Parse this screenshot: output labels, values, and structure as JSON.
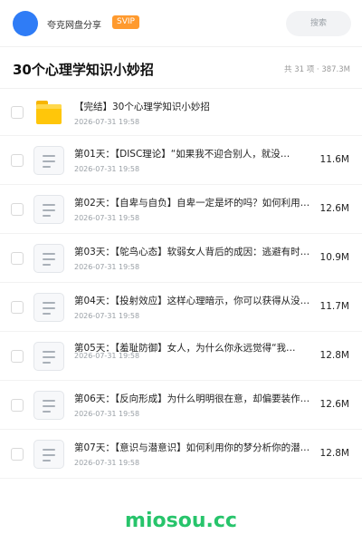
{
  "header": {
    "owner_name": "夸克网盘分享",
    "badge": "SVIP",
    "search_placeholder": "搜索"
  },
  "folder": {
    "title": "30个心理学知识小妙招",
    "summary": "共 31 项 · 387.3M"
  },
  "files": [
    {
      "name": "【完结】30个心理学知识小妙招",
      "date": "2026-07-31 19:58",
      "size": "",
      "type": "folder"
    },
    {
      "name": "第01天：【DISC理论】“如果我不迎合别人，就没…",
      "date": "2026-07-31 19:58",
      "size": "11.6M",
      "type": "doc"
    },
    {
      "name": "第02天：【自卑与自负】自卑一定是坏的吗？如何利用…",
      "date": "2026-07-31 19:58",
      "size": "12.6M",
      "type": "doc"
    },
    {
      "name": "第03天：【鸵鸟心态】软弱女人背后的成因：逃避有时…",
      "date": "2026-07-31 19:58",
      "size": "10.9M",
      "type": "doc"
    },
    {
      "name": "第04天：【投射效应】这样心理暗示，你可以获得从没…",
      "date": "2026-07-31 19:58",
      "size": "11.7M",
      "type": "doc"
    },
    {
      "name": "第05天：【羞耻防御】女人，为什么你永远觉得“我…",
      "date": "2026-07-31 19:58",
      "size": "12.8M",
      "type": "doc"
    },
    {
      "name": "第06天：【反向形成】为什么明明很在意，却偏要装作…",
      "date": "2026-07-31 19:58",
      "size": "12.6M",
      "type": "doc"
    },
    {
      "name": "第07天：【意识与潜意识】如何利用你的梦分析你的潜…",
      "date": "2026-07-31 19:58",
      "size": "12.8M",
      "type": "doc"
    }
  ],
  "watermark": "miosou.cc",
  "colors": {
    "accent_blue": "#2f7cf6",
    "svip_orange": "#ff9a2e",
    "folder_yellow": "#ffc60a",
    "watermark_green": "#27c46b"
  }
}
